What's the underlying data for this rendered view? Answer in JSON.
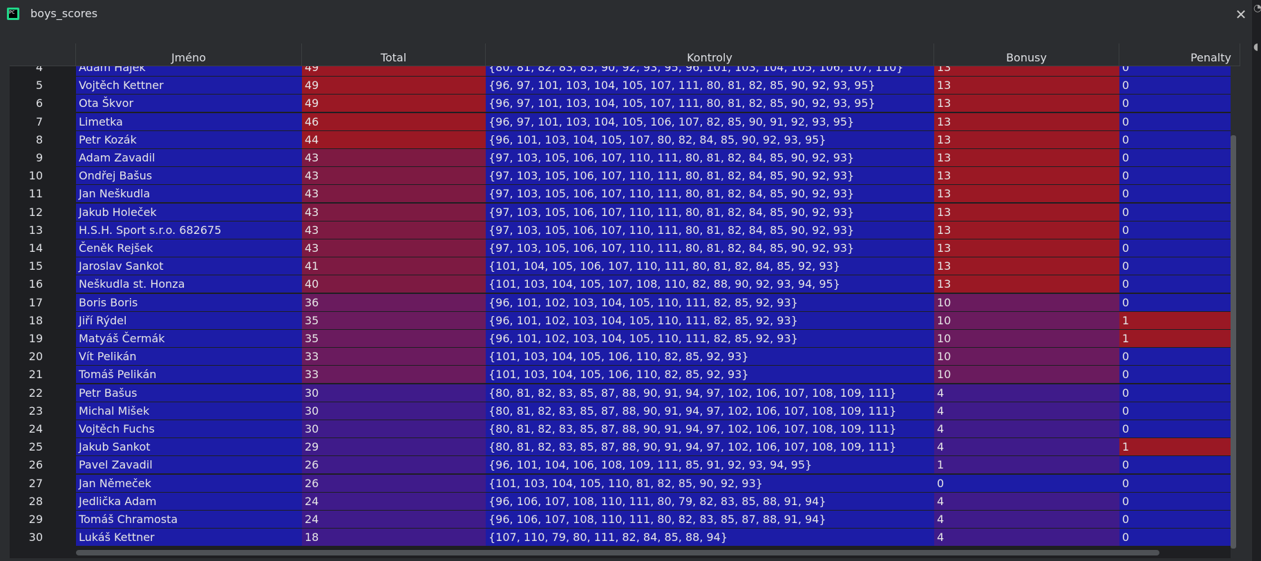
{
  "window": {
    "title": "boys_scores",
    "close_glyph": "✕"
  },
  "colors": {
    "blue": "#1c1ca6",
    "red": "#9a1824",
    "purple_mid": "#6a1b5e",
    "purple_low": "#3f1b8a"
  },
  "table": {
    "headers": [
      "Jméno",
      "Total",
      "Kontroly",
      "Bonusy",
      "Penalty"
    ],
    "rows": [
      {
        "n": "4",
        "name": "Adam Hájek",
        "total": "49",
        "k": "{80, 81, 82, 83, 85, 90, 92, 93, 95, 96, 101, 103, 104, 105, 106, 107, 110}",
        "b": "13",
        "p": "0"
      },
      {
        "n": "5",
        "name": "Vojtěch Kettner",
        "total": "49",
        "k": "{96, 97, 101, 103, 104, 105, 107, 111, 80, 81, 82, 85, 90, 92, 93, 95}",
        "b": "13",
        "p": "0"
      },
      {
        "n": "6",
        "name": "Ota Škvor",
        "total": "49",
        "k": "{96, 97, 101, 103, 104, 105, 107, 111, 80, 81, 82, 85, 90, 92, 93, 95}",
        "b": "13",
        "p": "0"
      },
      {
        "n": "7",
        "name": " Limetka",
        "total": "46",
        "k": "{96, 97, 101, 103, 104, 105, 106, 107, 82, 85, 90, 91, 92, 93, 95}",
        "b": "13",
        "p": "0"
      },
      {
        "n": "8",
        "name": "Petr Kozák",
        "total": "44",
        "k": "{96, 101, 103, 104, 105, 107, 80, 82, 84, 85, 90, 92, 93, 95}",
        "b": "13",
        "p": "0"
      },
      {
        "n": "9",
        "name": "Adam Zavadil",
        "total": "43",
        "k": "{97, 103, 105, 106, 107, 110, 111, 80, 81, 82, 84, 85, 90, 92, 93}",
        "b": "13",
        "p": "0"
      },
      {
        "n": "10",
        "name": "Ondřej Bašus",
        "total": "43",
        "k": "{97, 103, 105, 106, 107, 110, 111, 80, 81, 82, 84, 85, 90, 92, 93}",
        "b": "13",
        "p": "0"
      },
      {
        "n": "11",
        "name": "Jan Neškudla",
        "total": "43",
        "k": "{97, 103, 105, 106, 107, 110, 111, 80, 81, 82, 84, 85, 90, 92, 93}",
        "b": "13",
        "p": "0"
      },
      {
        "n": "12",
        "name": "Jakub Holeček",
        "total": "43",
        "k": "{97, 103, 105, 106, 107, 110, 111, 80, 81, 82, 84, 85, 90, 92, 93}",
        "b": "13",
        "p": "0"
      },
      {
        "n": "13",
        "name": "H.S.H. Sport s.r.o. 682675",
        "total": "43",
        "k": "{97, 103, 105, 106, 107, 110, 111, 80, 81, 82, 84, 85, 90, 92, 93}",
        "b": "13",
        "p": "0"
      },
      {
        "n": "14",
        "name": "Čeněk Rejšek",
        "total": "43",
        "k": "{97, 103, 105, 106, 107, 110, 111, 80, 81, 82, 84, 85, 90, 92, 93}",
        "b": "13",
        "p": "0"
      },
      {
        "n": "15",
        "name": "Jaroslav Sankot",
        "total": "41",
        "k": "{101, 104, 105, 106, 107, 110, 111, 80, 81, 82, 84, 85, 92, 93}",
        "b": "13",
        "p": "0"
      },
      {
        "n": "16",
        "name": "Neškudla st. Honza",
        "total": "40",
        "k": "{101, 103, 104, 105, 107, 108, 110, 82, 88, 90, 92, 93, 94, 95}",
        "b": "13",
        "p": "0"
      },
      {
        "n": "17",
        "name": "Boris Boris",
        "total": "36",
        "k": "{96, 101, 102, 103, 104, 105, 110, 111, 82, 85, 92, 93}",
        "b": "10",
        "p": "0"
      },
      {
        "n": "18",
        "name": "Jiří Rýdel",
        "total": "35",
        "k": "{96, 101, 102, 103, 104, 105, 110, 111, 82, 85, 92, 93}",
        "b": "10",
        "p": "1"
      },
      {
        "n": "19",
        "name": "Matyáš Čermák",
        "total": "35",
        "k": "{96, 101, 102, 103, 104, 105, 110, 111, 82, 85, 92, 93}",
        "b": "10",
        "p": "1"
      },
      {
        "n": "20",
        "name": "Vít Pelikán",
        "total": "33",
        "k": "{101, 103, 104, 105, 106, 110, 82, 85, 92, 93}",
        "b": "10",
        "p": "0"
      },
      {
        "n": "21",
        "name": "Tomáš Pelikán",
        "total": "33",
        "k": "{101, 103, 104, 105, 106, 110, 82, 85, 92, 93}",
        "b": "10",
        "p": "0"
      },
      {
        "n": "22",
        "name": "Petr Bašus",
        "total": "30",
        "k": "{80, 81, 82, 83, 85, 87, 88, 90, 91, 94, 97, 102, 106, 107, 108, 109, 111}",
        "b": "4",
        "p": "0"
      },
      {
        "n": "23",
        "name": "Michal Mišek",
        "total": "30",
        "k": "{80, 81, 82, 83, 85, 87, 88, 90, 91, 94, 97, 102, 106, 107, 108, 109, 111}",
        "b": "4",
        "p": "0"
      },
      {
        "n": "24",
        "name": "Vojtěch Fuchs",
        "total": "30",
        "k": "{80, 81, 82, 83, 85, 87, 88, 90, 91, 94, 97, 102, 106, 107, 108, 109, 111}",
        "b": "4",
        "p": "0"
      },
      {
        "n": "25",
        "name": "Jakub Sankot",
        "total": "29",
        "k": "{80, 81, 82, 83, 85, 87, 88, 90, 91, 94, 97, 102, 106, 107, 108, 109, 111}",
        "b": "4",
        "p": "1"
      },
      {
        "n": "26",
        "name": "Pavel Zavadil",
        "total": "26",
        "k": "{96, 101, 104, 106, 108, 109, 111, 85, 91, 92, 93, 94, 95}",
        "b": "1",
        "p": "0"
      },
      {
        "n": "27",
        "name": "Jan Němeček",
        "total": "26",
        "k": "{101, 103, 104, 105, 110, 81, 82, 85, 90, 92, 93}",
        "b": "0",
        "p": "0"
      },
      {
        "n": "28",
        "name": "Jedlička Adam",
        "total": "24",
        "k": "{96, 106, 107, 108, 110, 111, 80, 79, 82, 83, 85, 88, 91, 94}",
        "b": "4",
        "p": "0"
      },
      {
        "n": "29",
        "name": "Tomáš Chramosta",
        "total": "24",
        "k": "{96, 106, 107, 108, 110, 111, 80, 82, 83, 85, 87, 88, 91, 94}",
        "b": "4",
        "p": "0"
      },
      {
        "n": "30",
        "name": "Lukáš Kettner",
        "total": "18",
        "k": "{107, 110, 79, 80, 111, 82, 84, 85, 88, 94}",
        "b": "4",
        "p": "0"
      }
    ]
  }
}
